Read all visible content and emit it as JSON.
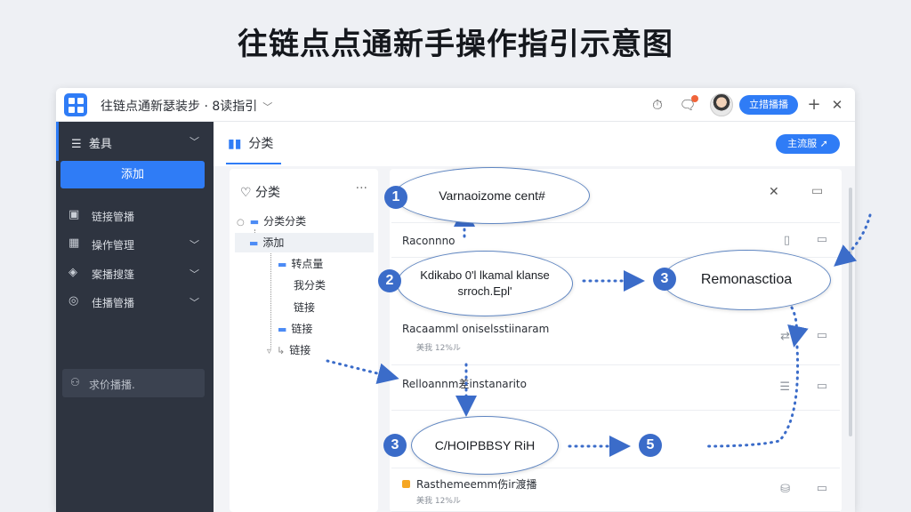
{
  "page_title": "往链点点通新手操作指引示意图",
  "titlebar": {
    "app_title": "往链点通新瑟装步 · 8读指引",
    "primary_button": "立措播播"
  },
  "sidebar": {
    "header": "羞具",
    "add_button": "添加",
    "items": [
      {
        "icon": "▣",
        "label": "链接管播",
        "has_arrow": false
      },
      {
        "icon": "▦",
        "label": "操作管理",
        "has_arrow": true
      },
      {
        "icon": "◈",
        "label": "案播搜篷",
        "has_arrow": true
      },
      {
        "icon": "◎",
        "label": "佳播管播",
        "has_arrow": true
      }
    ],
    "search_placeholder": "求价播播."
  },
  "content_header": {
    "tab_label": "分类",
    "action_button": "主流服"
  },
  "tree": {
    "title": "分类",
    "nodes": [
      {
        "label": "分类分类"
      },
      {
        "label": "添加"
      },
      {
        "label": "转点量"
      },
      {
        "label": "我分类"
      },
      {
        "label": "链接"
      },
      {
        "label": "链接"
      },
      {
        "label": "链接"
      }
    ]
  },
  "list": {
    "rows": [
      {
        "title": "Raconnno",
        "sub": ""
      },
      {
        "title": "Racaamml oniselsstiinaram",
        "sub": "美我 12%ル"
      },
      {
        "title": "Relloannm差instanarito",
        "sub": ""
      },
      {
        "title": "Rasthemeemm伤ir渡播",
        "sub": "美我 12%ル"
      }
    ]
  },
  "callouts": [
    {
      "number": "1",
      "text": "Varnaoizome cent#"
    },
    {
      "number": "2",
      "text": "Kdikabo 0'l lkamal klanse srroch.Epl'"
    },
    {
      "number": "3",
      "text": "Remonasctioa"
    },
    {
      "number": "3",
      "text": "C/HOIPBBSY RiH"
    },
    {
      "number": "5",
      "text": ""
    }
  ],
  "colors": {
    "accent": "#2f7cf6",
    "sidebar_bg": "#2e3440",
    "callout_border": "#5f86c2",
    "badge": "#3b6cc9",
    "arrow": "#3b6cc9"
  }
}
